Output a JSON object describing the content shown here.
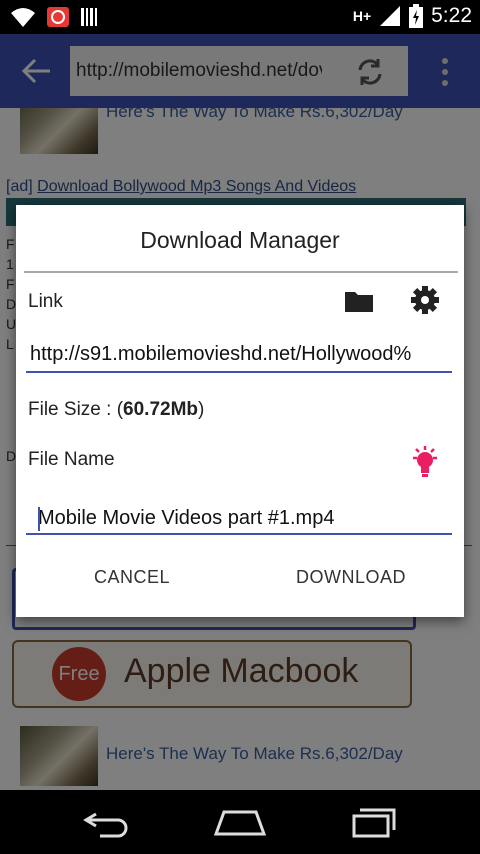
{
  "status": {
    "network": "H+",
    "time": "5:22"
  },
  "browser": {
    "url": "http://mobilemovieshd.net/dov"
  },
  "page": {
    "top_link": "Here's The Way To Make Rs.6,302/Day",
    "ad_prefix": "[ad]",
    "ad_link": "Download Bollywood Mp3 Songs And Videos",
    "side_letters": [
      "F",
      "1",
      "F",
      "D",
      "U",
      "L"
    ],
    "side_letter_d": "D",
    "banner_free": "Free",
    "banner_text": "Apple Macbook",
    "bottom_link": "Here's The Way To Make Rs.6,302/Day"
  },
  "dialog": {
    "title": "Download Manager",
    "link_label": "Link",
    "link_value": "http://s91.mobilemovieshd.net/Hollywood%",
    "file_size_label": "File Size : (",
    "file_size_value": "60.72Mb",
    "file_size_close": ")",
    "file_name_label": "File Name",
    "file_name_value": "Mobile Movie Videos part #1.mp4",
    "cancel_label": "CANCEL",
    "download_label": "DOWNLOAD"
  },
  "colors": {
    "toolbar": "#3f51b5",
    "accent": "#3f51b5",
    "bulb": "#e91e63"
  },
  "icons": [
    "wifi-icon",
    "notification-icon",
    "barcode-icon",
    "signal-icon",
    "battery-icon",
    "back-arrow-icon",
    "refresh-icon",
    "overflow-menu-icon",
    "folder-icon",
    "settings-gear-icon",
    "lightbulb-icon",
    "nav-back-icon",
    "nav-home-icon",
    "nav-recents-icon"
  ]
}
